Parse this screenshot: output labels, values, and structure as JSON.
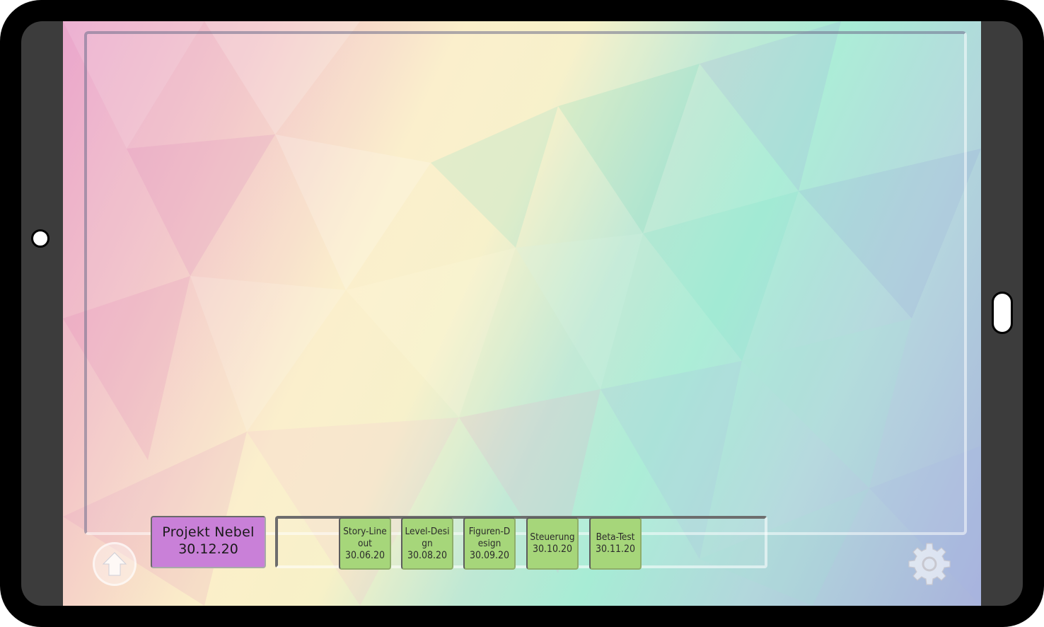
{
  "project": {
    "name": "Projekt Nebel",
    "date": "30.12.20"
  },
  "tasks": [
    {
      "label": "Story-Line out",
      "date": "30.06.20"
    },
    {
      "label": "Level-Desi gn",
      "date": "30.08.20"
    },
    {
      "label": "Figuren-D esign",
      "date": "30.09.20"
    },
    {
      "label": "Steuerung",
      "date": "30.10.20"
    },
    {
      "label": "Beta-Test",
      "date": "30.11.20"
    }
  ],
  "icons": {
    "navigation": "arrow-up-icon",
    "settings": "gear-icon"
  },
  "colors": {
    "project": "#c980d8",
    "task": "#a6d67a",
    "device": "#000000",
    "bezel": "#3c3c3c"
  }
}
